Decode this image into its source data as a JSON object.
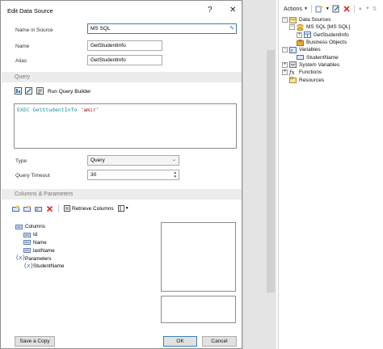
{
  "dialog": {
    "title": "Edit Data Source",
    "help_glyph": "?",
    "close_glyph": "✕",
    "name_in_source_label": "Name in Source",
    "name_in_source_value": "MS SQL",
    "name_label": "Name",
    "name_value": "GetStudentInfo",
    "alias_label": "Alias",
    "alias_value": "GetStudentInfo",
    "query_section": "Query",
    "run_query_builder": "Run Query Builder",
    "query_text": {
      "exec": "EXEC GetStudentInfo",
      "arg": "'amir'"
    },
    "type_label": "Type",
    "type_value": "Query",
    "timeout_label": "Query Timeout",
    "timeout_value": "30",
    "columns_section": "Columns & Parameters",
    "retrieve_columns": "Retrieve Columns",
    "columns_tree": {
      "columns": "Columns",
      "col_items": [
        "Id",
        "Name",
        "lastName"
      ],
      "parameters": "Parameters",
      "param_items": [
        "StudentName"
      ]
    },
    "col_icon_text": "abc",
    "param_icon_text": "{x}",
    "save_copy": "Save a Copy",
    "ok": "OK",
    "cancel": "Cancel"
  },
  "dictionary": {
    "actions_label": "Actions",
    "tree": {
      "data_sources": "Data Sources",
      "ms_sql": "MS SQL [MS SQL]",
      "get_student_info": "GetStudentInfo",
      "business_objects": "Business Objects",
      "variables": "Variables",
      "student_name": "StudentName",
      "system_variables": "System Variables",
      "functions": "Functions",
      "resources": "Resources"
    }
  },
  "colors": {
    "keyword": "#1a8d9a",
    "string": "#a31515",
    "section_bg": "#ececec",
    "delete_icon": "#d9342b"
  }
}
